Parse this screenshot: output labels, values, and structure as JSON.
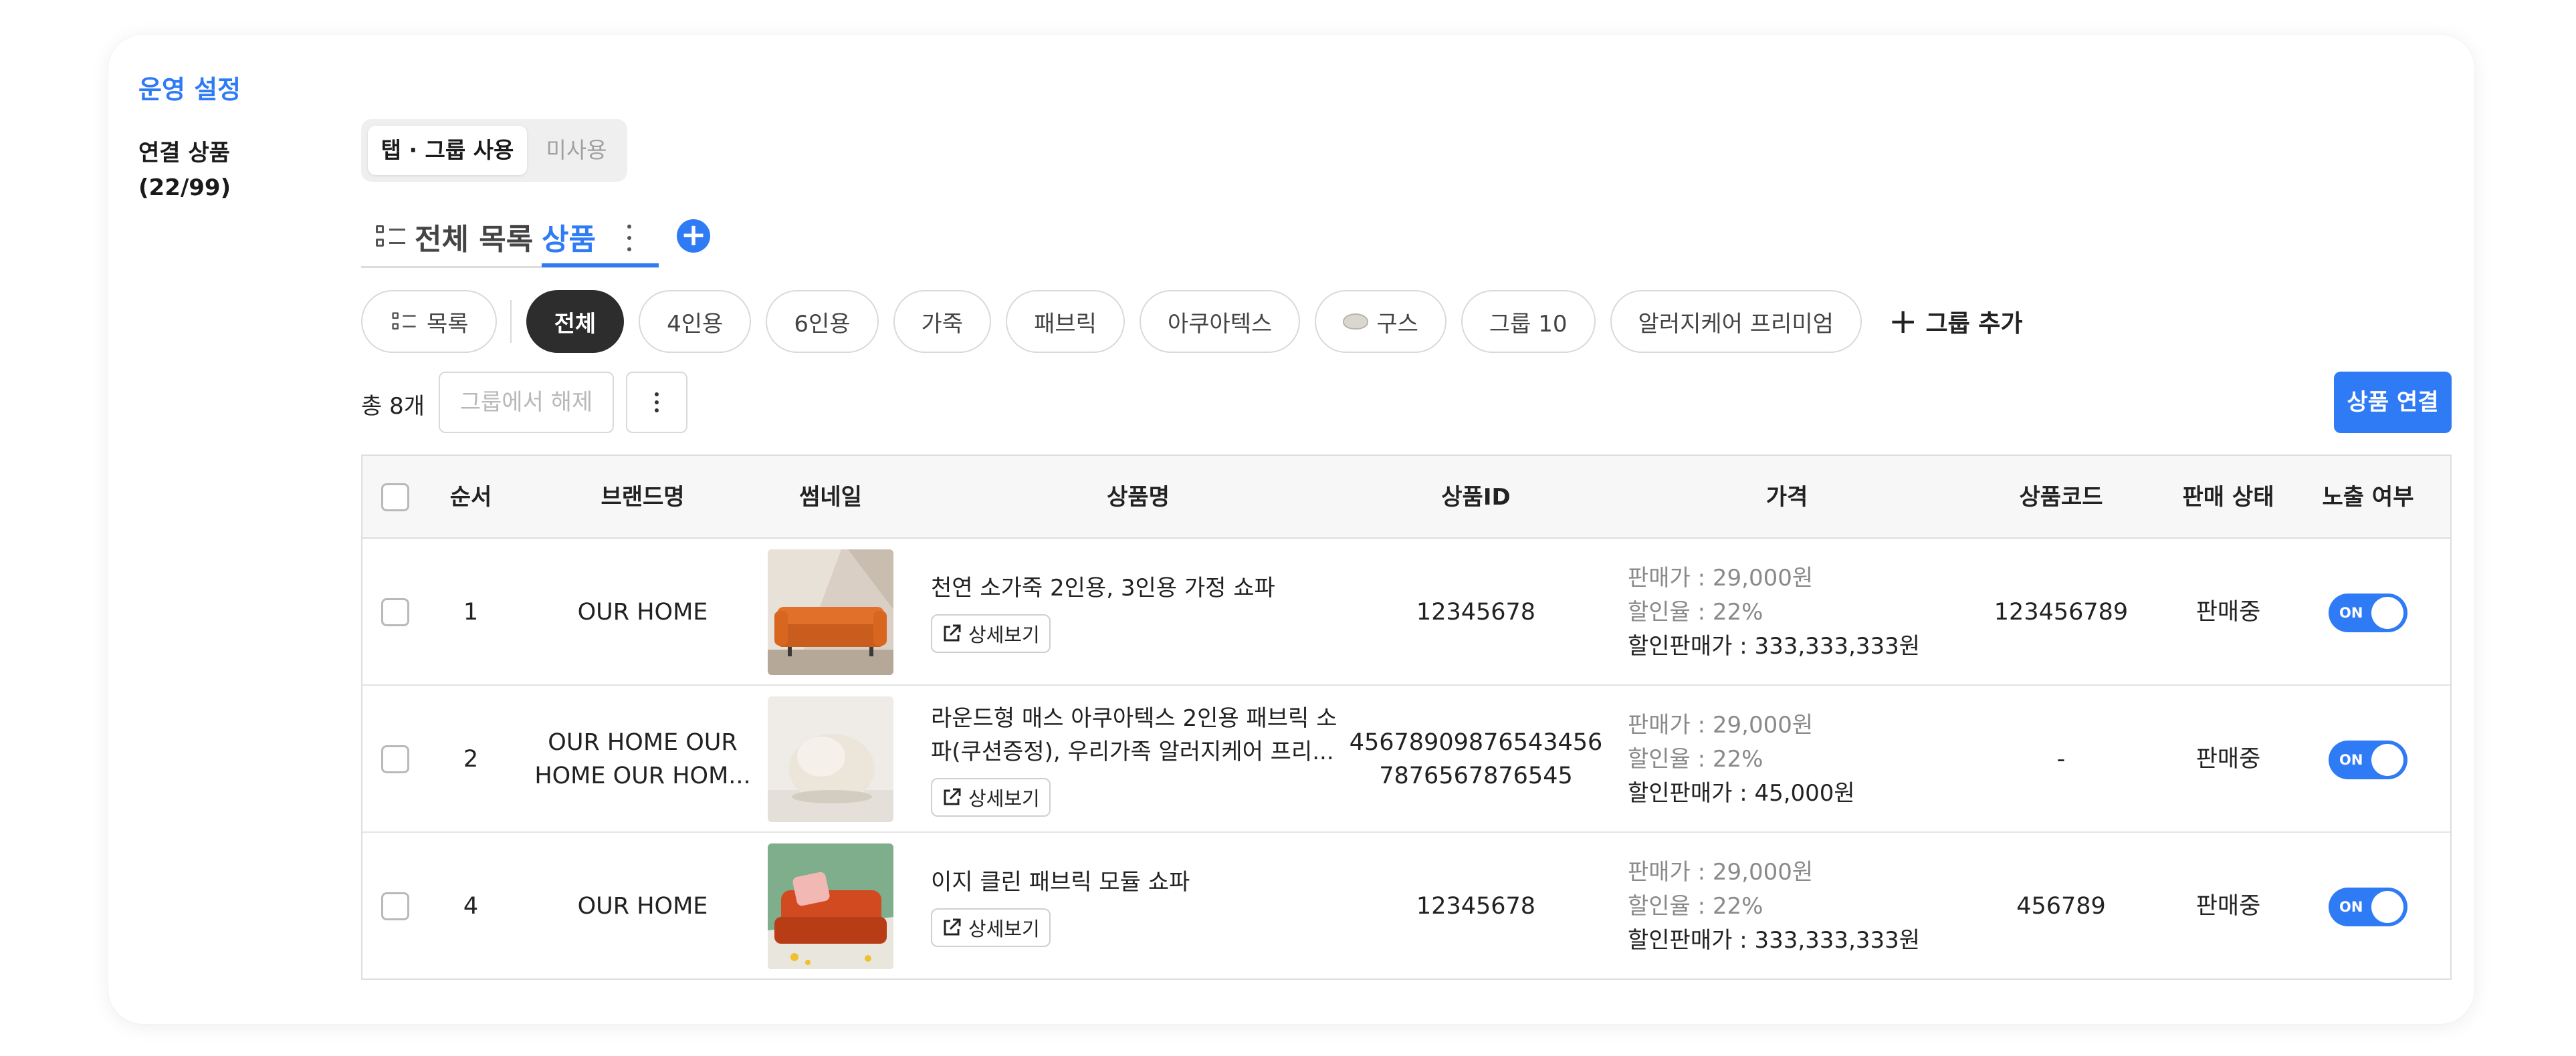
{
  "section_title": "운영 설정",
  "field": {
    "label_line1": "연결 상품",
    "label_line2": "(22/99)"
  },
  "segment": {
    "active": "탭 · 그룹 사용",
    "inactive": "미사용"
  },
  "tabs": {
    "all_label": "전체 목록",
    "product_label": "상품"
  },
  "chips": [
    {
      "label": "목록",
      "icon": "list-icon"
    },
    {
      "label": "전체",
      "active": true
    },
    {
      "label": "4인용"
    },
    {
      "label": "6인용"
    },
    {
      "label": "가죽"
    },
    {
      "label": "패브릭"
    },
    {
      "label": "아쿠아텍스"
    },
    {
      "label": "구스",
      "icon": "goose-icon"
    },
    {
      "label": "그룹 10"
    },
    {
      "label": "알러지케어 프리미엄"
    }
  ],
  "add_group_label": "그룹 추가",
  "toolbar": {
    "total": "총 8개",
    "release_label": "그룹에서 해제",
    "connect_label": "상품 연결"
  },
  "table": {
    "headers": [
      "순서",
      "브랜드명",
      "썸네일",
      "상품명",
      "상품ID",
      "가격",
      "상품코드",
      "판매 상태",
      "노출 여부"
    ],
    "detail_label": "상세보기",
    "toggle_label": "ON",
    "rows": [
      {
        "order": "1",
        "brand": "OUR HOME",
        "name": "천연 소가죽 2인용, 3인용 가정 쇼파",
        "product_id": "12345678",
        "price_sale": "판매가 : 29,000원",
        "price_rate": "할인율 : 22%",
        "price_final": "할인판매가 : 333,333,333원",
        "code": "123456789",
        "status": "판매중",
        "thumb": "orange-leather-sofa"
      },
      {
        "order": "2",
        "brand": "OUR HOME OUR HOME OUR HOM...",
        "name": "라운드형 매스 아쿠아텍스 2인용 패브릭 소파(쿠션증정), 우리가족 알러지케어 프리...",
        "product_id": "45678909876543456 7876567876545",
        "price_sale": "판매가 : 29,000원",
        "price_rate": "할인율 : 22%",
        "price_final": "할인판매가 : 45,000원",
        "code": "-",
        "status": "판매중",
        "thumb": "round-boucle-chair"
      },
      {
        "order": "4",
        "brand": "OUR HOME",
        "name": "이지 클린 패브릭 모듈 쇼파",
        "product_id": "12345678",
        "price_sale": "판매가 : 29,000원",
        "price_rate": "할인율 : 22%",
        "price_final": "할인판매가 : 333,333,333원",
        "code": "456789",
        "status": "판매중",
        "thumb": "red-fabric-sofa"
      }
    ]
  },
  "colors": {
    "accent": "#2f7bf5",
    "chip_active": "#2d2d2d"
  }
}
